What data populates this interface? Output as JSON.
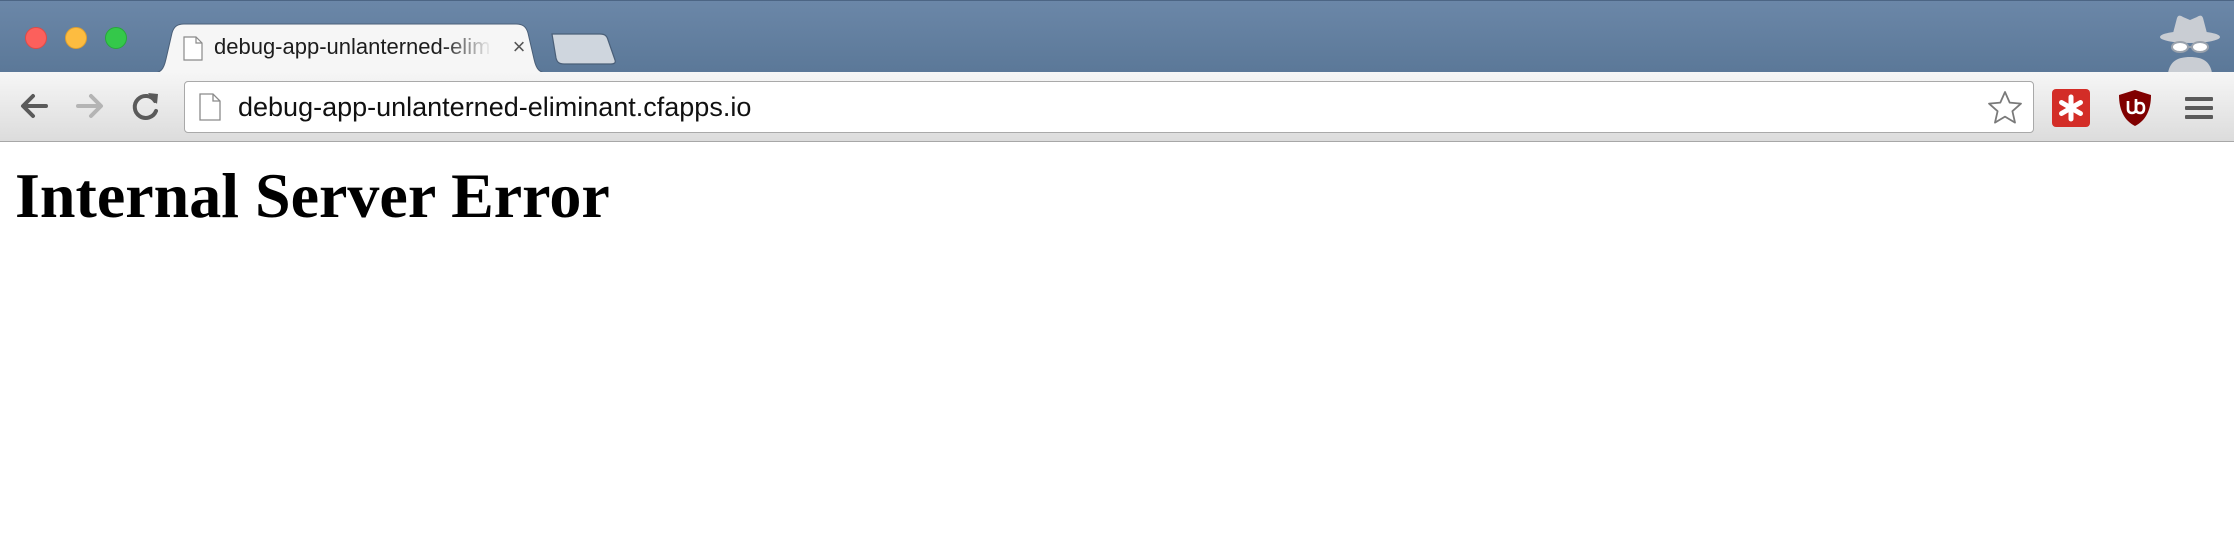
{
  "window": {
    "traffic_lights": [
      "close",
      "minimize",
      "maximize"
    ]
  },
  "tabs": [
    {
      "title": "debug-app-unlanterned-eliminant.cfapps.io",
      "icon": "page-icon",
      "close_icon": "×",
      "active": true
    }
  ],
  "new_tab_icon": "new-tab-icon",
  "incognito_icon": "incognito-icon",
  "toolbar": {
    "back_icon": "back-arrow-icon",
    "forward_icon": "forward-arrow-icon",
    "reload_icon": "reload-icon",
    "omnibox": {
      "url": "debug-app-unlanterned-eliminant.cfapps.io",
      "page_icon": "page-icon",
      "star_icon": "bookmark-star-icon"
    },
    "extensions": [
      {
        "name": "lastpass-extension",
        "icon": "asterisk-icon",
        "color": "#d32d27"
      },
      {
        "name": "ublock-extension",
        "icon": "shield-icon",
        "color": "#800000"
      }
    ],
    "menu_icon": "hamburger-menu-icon"
  },
  "page": {
    "heading": "Internal Server Error"
  },
  "colors": {
    "tabstrip": "#5b7898",
    "toolbar": "#e8e8e8",
    "close": "#fc605c",
    "minimize": "#fdbc40",
    "maximize": "#34c84a"
  }
}
